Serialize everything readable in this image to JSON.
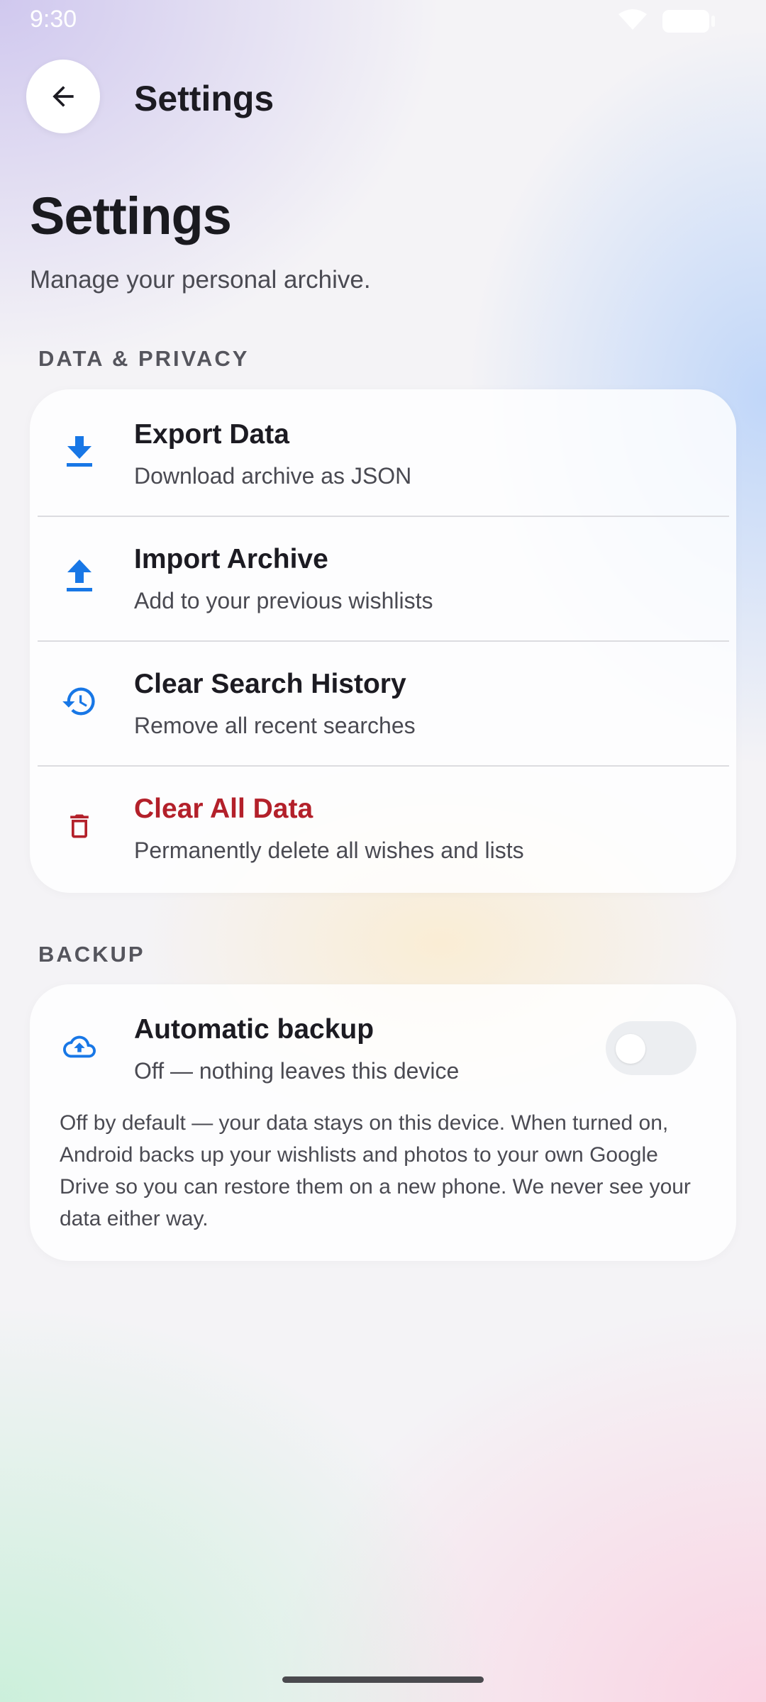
{
  "status_bar": {
    "time": "9:30"
  },
  "top_bar": {
    "title": "Settings"
  },
  "header": {
    "title": "Settings",
    "subtitle": "Manage your personal archive."
  },
  "data_privacy": {
    "label": "DATA & PRIVACY",
    "items": [
      {
        "icon": "download-icon",
        "title": "Export Data",
        "subtitle": "Download archive as JSON"
      },
      {
        "icon": "upload-icon",
        "title": "Import Archive",
        "subtitle": "Add to your previous wishlists"
      },
      {
        "icon": "history-icon",
        "title": "Clear Search History",
        "subtitle": "Remove all recent searches"
      },
      {
        "icon": "trash-icon",
        "title": "Clear All Data",
        "subtitle": "Permanently delete all wishes and lists"
      }
    ]
  },
  "backup": {
    "label": "BACKUP",
    "icon": "cloud-upload-icon",
    "title": "Automatic backup",
    "subtitle": "Off — nothing leaves this device",
    "toggle_on": false,
    "description": "Off by default — your data stays on this device. When turned on, Android backs up your wishlists and photos to your own Google Drive so you can restore them on a new phone. We never see your data either way."
  },
  "colors": {
    "accent": "#1877e6",
    "danger": "#b3202a",
    "text_primary": "#1c1b22",
    "text_secondary": "#4a4a52"
  }
}
